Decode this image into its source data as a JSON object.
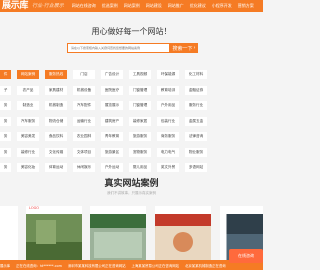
{
  "header": {
    "logo": "展示库",
    "slogan": "行业·行业展示",
    "nav": [
      "网站在线咨询",
      "优选案例",
      "网站案例",
      "网站建设",
      "网站推广",
      "优化建议",
      "小程序开发",
      "营销方案"
    ]
  },
  "hero": {
    "title": "用心做好每一个网站！",
    "search_placeholder": "请在以下搜索框内输入关键词查找您想要的网站案例",
    "search_button": "搜索一下"
  },
  "categories": [
    [
      "件",
      "网站案例",
      "服务热线",
      "门店",
      "广告设计",
      "工具视频",
      "环保能源",
      "化工材料"
    ],
    [
      "子",
      "农产品",
      "家具建材",
      "机械设备",
      "医院医疗",
      "门窗管理",
      "教育培训",
      "金融证券"
    ],
    [
      "务",
      "制造业",
      "机械制造",
      "汽车配件",
      "展览展示",
      "门窗管理",
      "户外用品",
      "服务行业"
    ],
    [
      "务",
      "汽车服务",
      "物流仓储",
      "运输行业",
      "建筑房产",
      "装修家居",
      "包装行业",
      "金属五金"
    ],
    [
      "务",
      "美容美发",
      "食品饮料",
      "农业园林",
      "青年教育",
      "旅游服务",
      "商务服务",
      "法律咨询"
    ],
    [
      "务",
      "装修行业",
      "文化传媒",
      "文体项目",
      "旅游景区",
      "宠物服务",
      "电力电气",
      "物业服务"
    ],
    [
      "务",
      "美容化妆",
      "体育运动",
      "休闲娱乐",
      "户外运动",
      "婴儿用品",
      "英文外贸",
      "多语网站"
    ]
  ],
  "cases": {
    "title": "真实网站案例",
    "subtitle": "我们不讲故事，只展示真实案例",
    "thumbs": [
      "LOGO",
      "",
      "",
      "",
      ""
    ]
  },
  "ticker": [
    "展示库",
    "正在在线咨询：ht******.com",
    "深圳市某某科技有限公司正在咨询网站",
    "上海某某贸易公司正在咨询网站",
    "北京某某机械制造正在咨询"
  ],
  "float_button": "在线咨询",
  "colors": {
    "accent": "#f57b24",
    "background": "#f4f4f4"
  }
}
